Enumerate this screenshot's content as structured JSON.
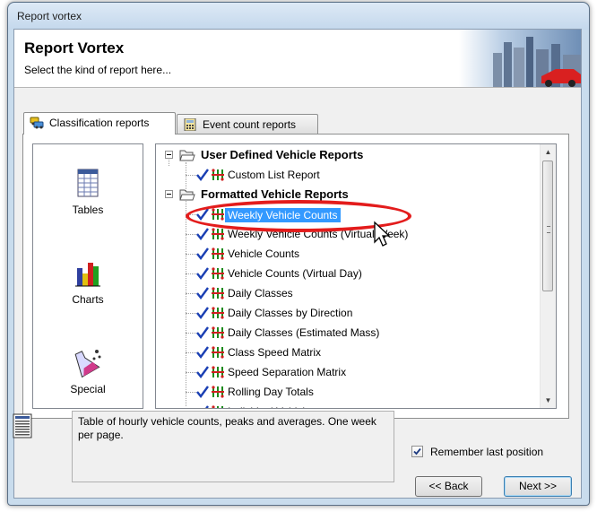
{
  "window": {
    "title": "Report vortex"
  },
  "banner": {
    "title": "Report Vortex",
    "subtitle": "Select the kind of report here..."
  },
  "tabs": [
    {
      "label": "Classification reports",
      "active": true,
      "icon": "vehicles-icon"
    },
    {
      "label": "Event count reports",
      "active": false,
      "icon": "calculator-icon"
    }
  ],
  "categories": [
    {
      "label": "Tables",
      "icon": "table-icon"
    },
    {
      "label": "Charts",
      "icon": "bar-chart-icon"
    },
    {
      "label": "Special",
      "icon": "flask-icon"
    }
  ],
  "tree": {
    "groups": [
      {
        "label": "User Defined Vehicle Reports",
        "items": [
          "Custom List Report"
        ]
      },
      {
        "label": "Formatted Vehicle Reports",
        "items": [
          "Weekly Vehicle Counts",
          "Weekly Vehicle Counts (Virtual Week)",
          "Vehicle Counts",
          "Vehicle Counts (Virtual Day)",
          "Daily Classes",
          "Daily Classes by Direction",
          "Daily Classes (Estimated Mass)",
          "Class Speed Matrix",
          "Speed Separation Matrix",
          "Rolling Day Totals",
          "Individual Vehicles"
        ]
      }
    ],
    "selected": "Weekly Vehicle Counts"
  },
  "description": "Table of hourly vehicle counts, peaks and averages. One week per page.",
  "remember": {
    "label": "Remember last position",
    "checked": true
  },
  "buttons": {
    "back": "<< Back",
    "next": "Next >>"
  },
  "colors": {
    "selection": "#3399ff",
    "annotation": "#e31c1c",
    "check": "#1a3fb3"
  }
}
